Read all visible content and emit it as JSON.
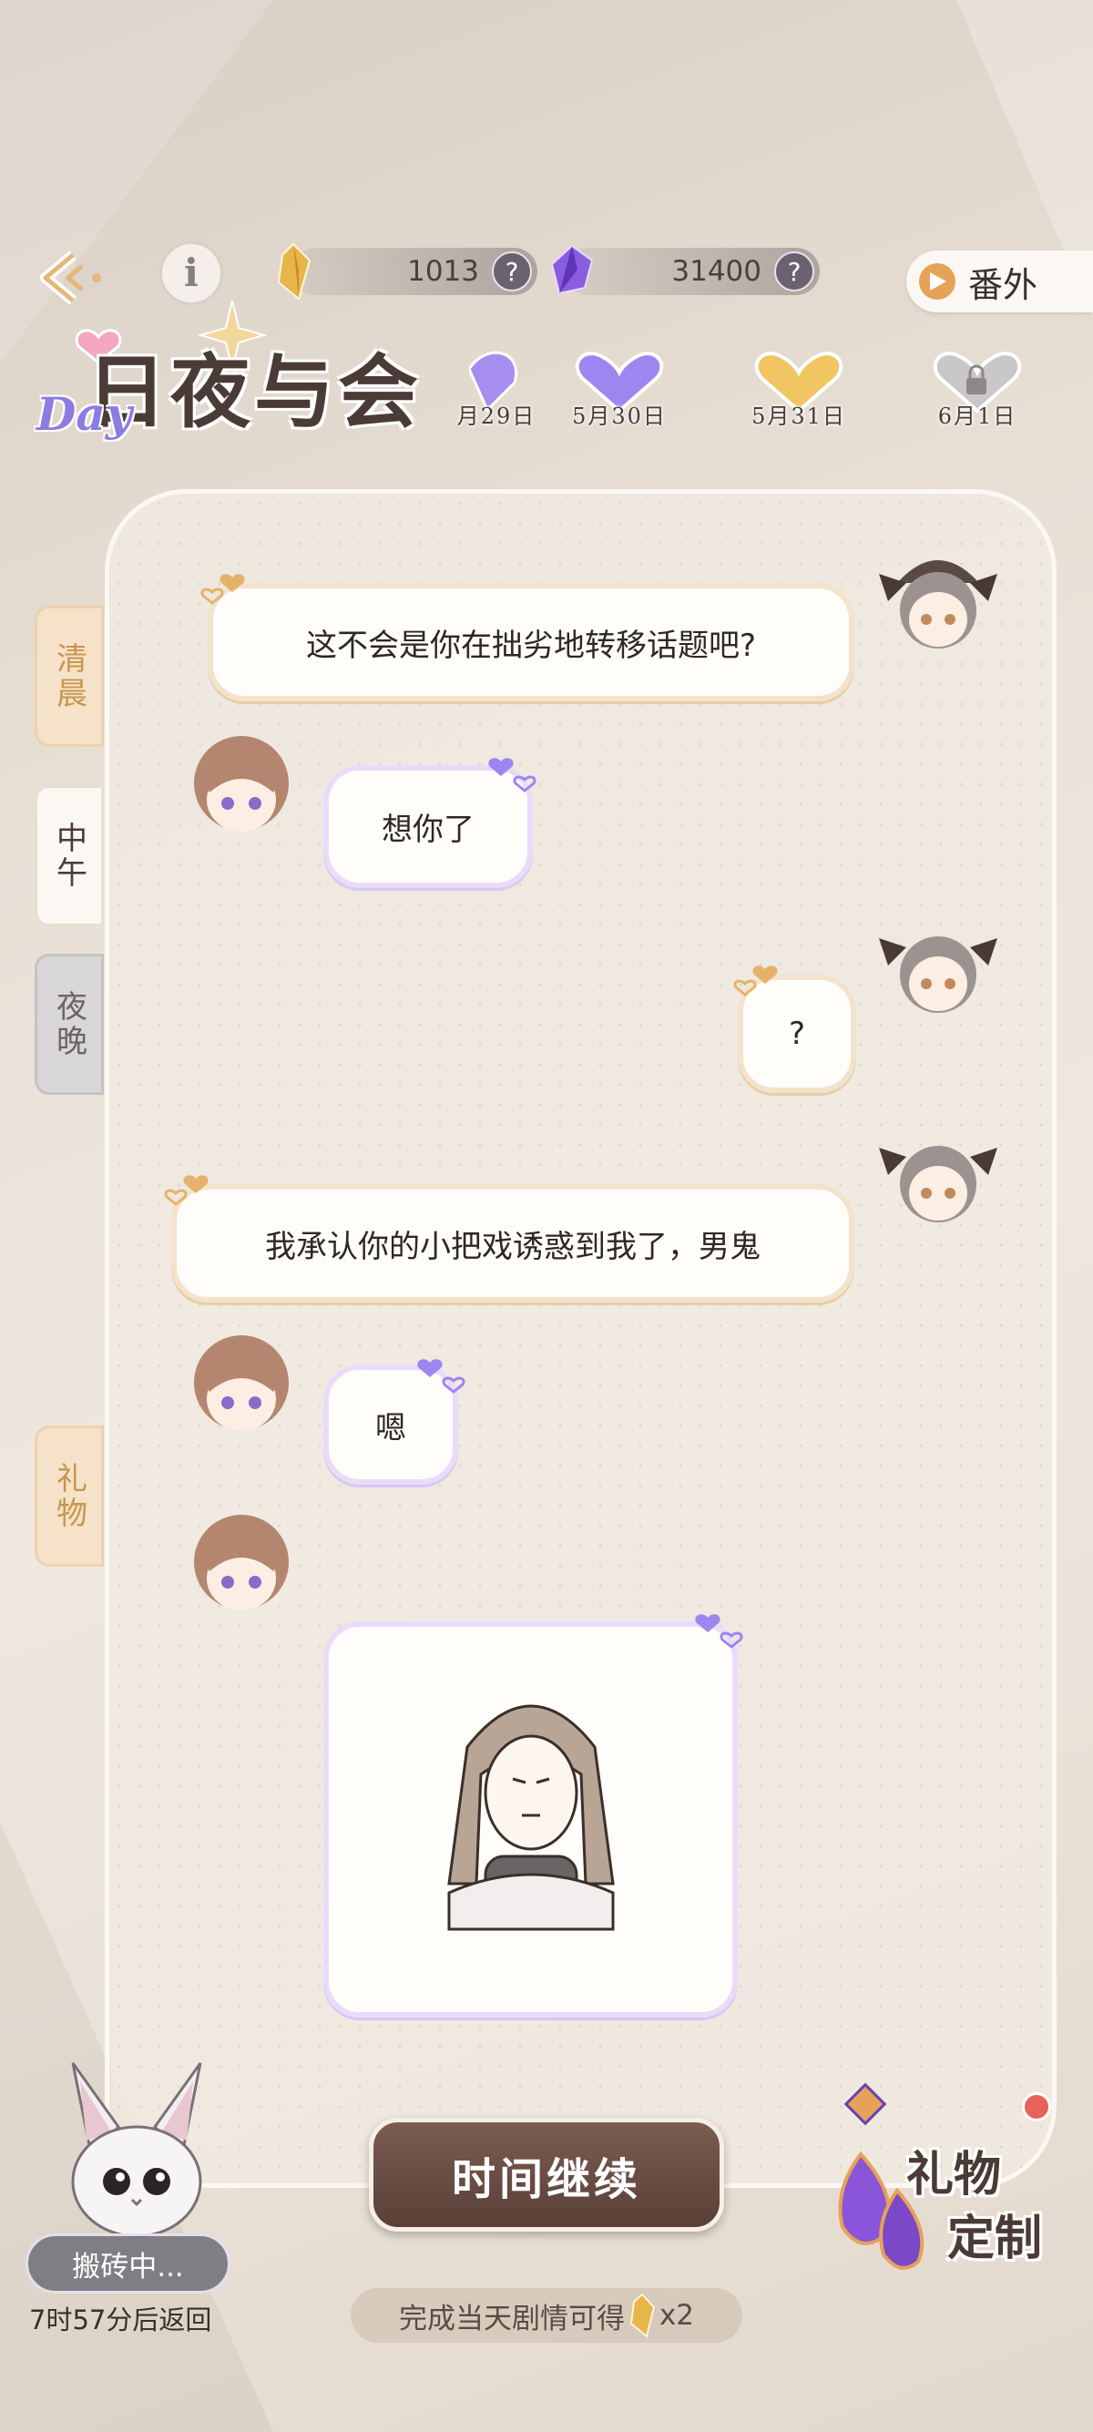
{
  "header": {
    "back_icon": "back-arrow-icon",
    "info_icon": "info-icon",
    "info_glyph": "i",
    "gold_currency": "1013",
    "purple_currency": "31400",
    "help_glyph": "?",
    "extra_label": "番外"
  },
  "logo": {
    "title": "日夜与会",
    "day": "Day"
  },
  "dates": [
    {
      "label": "月29日",
      "state": "purple"
    },
    {
      "label": "5月30日",
      "state": "purple"
    },
    {
      "label": "5月31日",
      "state": "gold"
    },
    {
      "label": "6月1日",
      "state": "locked"
    }
  ],
  "side_tabs": {
    "morning": "清晨",
    "noon": "中午",
    "night": "夜晚",
    "gift": "礼物"
  },
  "messages": [
    {
      "side": "right",
      "text": "这不会是你在拙劣地转移话题吧?"
    },
    {
      "side": "left",
      "text": "想你了"
    },
    {
      "side": "right",
      "text": "?"
    },
    {
      "side": "right",
      "text": "我承认你的小把戏诱惑到我了，男鬼"
    },
    {
      "side": "left",
      "text": "嗯"
    },
    {
      "side": "left",
      "type": "sticker",
      "sticker": "arms-crossed-sticker"
    }
  ],
  "bottom": {
    "continue_label": "时间继续",
    "reward_note": "完成当天剧情可得",
    "reward_count": "x2",
    "work_status": "搬砖中...",
    "return_time": "7时57分后返回",
    "gift_custom_1": "礼物",
    "gift_custom_2": "定制"
  },
  "colors": {
    "accent_gold": "#e6a256",
    "accent_purple": "#8c7ce0",
    "button_brown": "#6a4c42",
    "notif_red": "#e8625a"
  }
}
